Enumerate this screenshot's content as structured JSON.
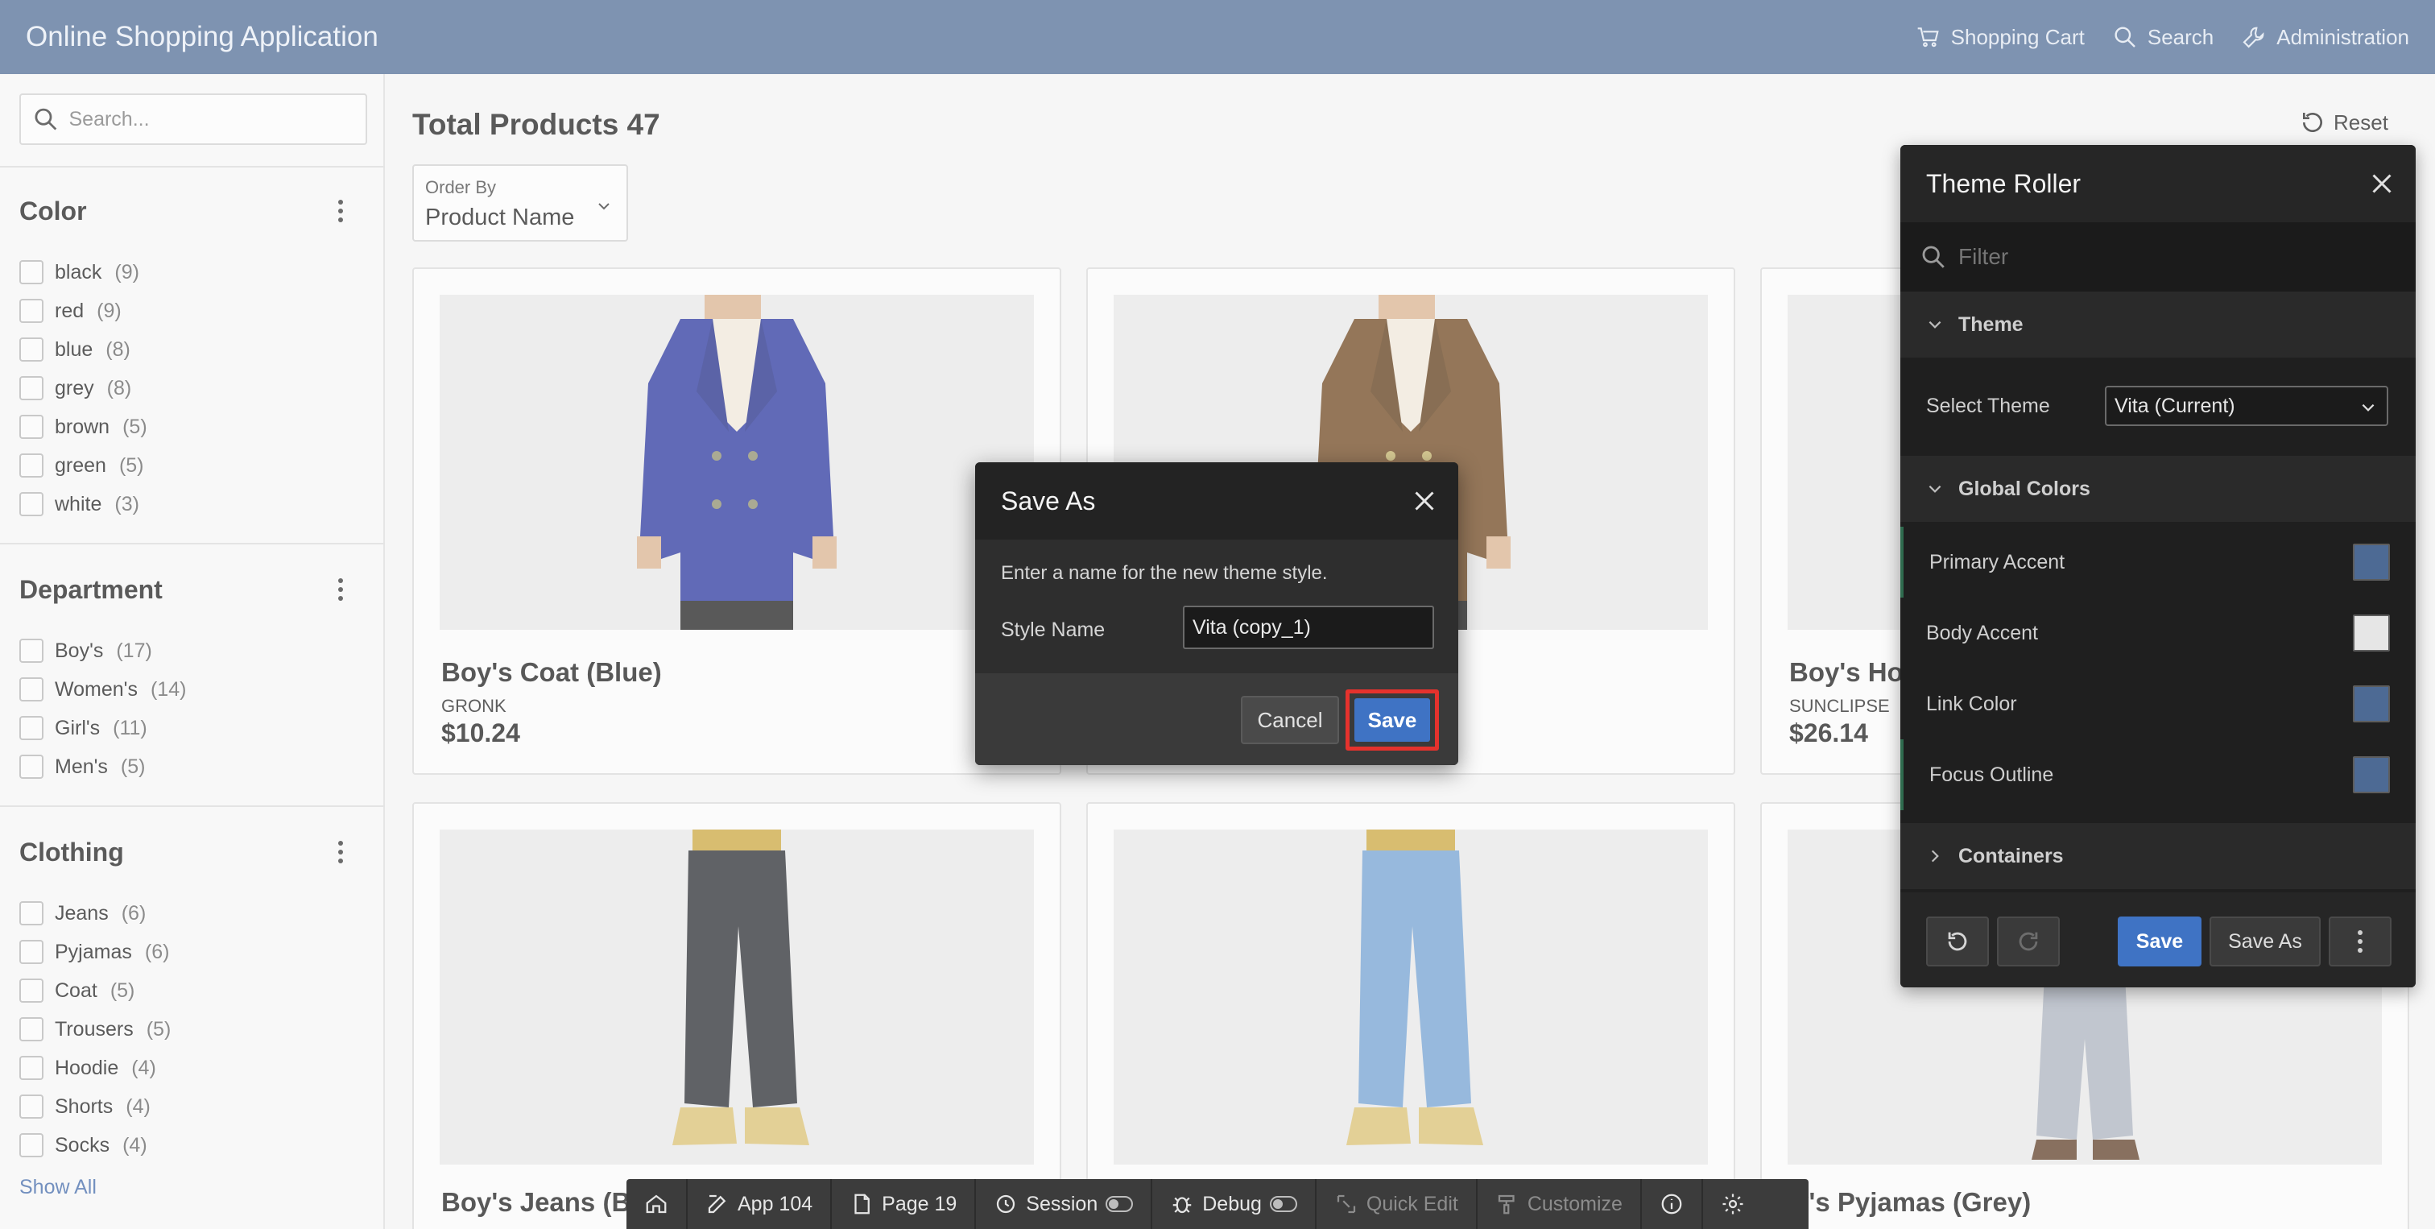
{
  "header": {
    "app_title": "Online Shopping Application",
    "links": [
      {
        "label": "Shopping Cart",
        "icon": "cart-icon"
      },
      {
        "label": "Search",
        "icon": "search-icon"
      },
      {
        "label": "Administration",
        "icon": "wrench-icon"
      }
    ]
  },
  "sidebar": {
    "search_placeholder": "Search...",
    "facets": [
      {
        "title": "Color",
        "items": [
          {
            "label": "black",
            "count": "(9)"
          },
          {
            "label": "red",
            "count": "(9)"
          },
          {
            "label": "blue",
            "count": "(8)"
          },
          {
            "label": "grey",
            "count": "(8)"
          },
          {
            "label": "brown",
            "count": "(5)"
          },
          {
            "label": "green",
            "count": "(5)"
          },
          {
            "label": "white",
            "count": "(3)"
          }
        ]
      },
      {
        "title": "Department",
        "items": [
          {
            "label": "Boy's",
            "count": "(17)"
          },
          {
            "label": "Women's",
            "count": "(14)"
          },
          {
            "label": "Girl's",
            "count": "(11)"
          },
          {
            "label": "Men's",
            "count": "(5)"
          }
        ]
      },
      {
        "title": "Clothing",
        "items": [
          {
            "label": "Jeans",
            "count": "(6)"
          },
          {
            "label": "Pyjamas",
            "count": "(6)"
          },
          {
            "label": "Coat",
            "count": "(5)"
          },
          {
            "label": "Trousers",
            "count": "(5)"
          },
          {
            "label": "Hoodie",
            "count": "(4)"
          },
          {
            "label": "Shorts",
            "count": "(4)"
          },
          {
            "label": "Socks",
            "count": "(4)"
          }
        ]
      }
    ],
    "show_all": "Show All"
  },
  "main": {
    "title": "Total Products 47",
    "reset_label": "Reset",
    "order_by_label": "Order By",
    "order_by_value": "Product Name",
    "products": [
      {
        "name": "Boy's Coat (Blue)",
        "brand": "GRONK",
        "price": "$10.24",
        "image": "blue-coat"
      },
      {
        "name": "",
        "brand": "",
        "price": "",
        "image": "brown-coat"
      },
      {
        "name": "Boy's Ho",
        "brand": "SUNCLIPSE",
        "price": "$26.14",
        "image": "hoodie"
      },
      {
        "name": "Boy's Jeans (Bl",
        "brand": "",
        "price": "",
        "image": "black-jeans"
      },
      {
        "name": "",
        "brand": "",
        "price": "",
        "image": "blue-jeans"
      },
      {
        "name": "oy's Pyjamas (Grey)",
        "brand": "",
        "price": "",
        "image": "grey-pyjamas"
      }
    ]
  },
  "theme_roller": {
    "title": "Theme Roller",
    "filter_placeholder": "Filter",
    "theme_section": "Theme",
    "select_theme_label": "Select Theme",
    "select_theme_value": "Vita (Current)",
    "global_colors_section": "Global Colors",
    "colors": [
      {
        "label": "Primary Accent",
        "value": "#4d6a94"
      },
      {
        "label": "Body Accent",
        "value": "#e6e6e6"
      },
      {
        "label": "Link Color",
        "value": "#4d6a94"
      },
      {
        "label": "Focus Outline",
        "value": "#4d6a94"
      }
    ],
    "containers_section": "Containers",
    "save_label": "Save",
    "save_as_label": "Save As"
  },
  "save_as_dialog": {
    "title": "Save As",
    "message": "Enter a name for the new theme style.",
    "style_name_label": "Style Name",
    "style_name_value": "Vita (copy_1)",
    "cancel_label": "Cancel",
    "save_label": "Save"
  },
  "dev_toolbar": {
    "items": [
      {
        "label": "",
        "icon": "home-icon"
      },
      {
        "label": "App 104",
        "icon": "edit-icon"
      },
      {
        "label": "Page 19",
        "icon": "page-icon"
      },
      {
        "label": "Session",
        "icon": "session-icon"
      },
      {
        "label": "Debug",
        "icon": "bug-icon"
      },
      {
        "label": "Quick Edit",
        "icon": "quick-edit-icon"
      },
      {
        "label": "Customize",
        "icon": "brush-icon"
      },
      {
        "label": "",
        "icon": "info-icon"
      },
      {
        "label": "",
        "icon": "gear-icon"
      }
    ]
  },
  "colors": {
    "header": "#4d6a94",
    "primary_button": "#3f73c4",
    "highlight": "#e5322d"
  }
}
